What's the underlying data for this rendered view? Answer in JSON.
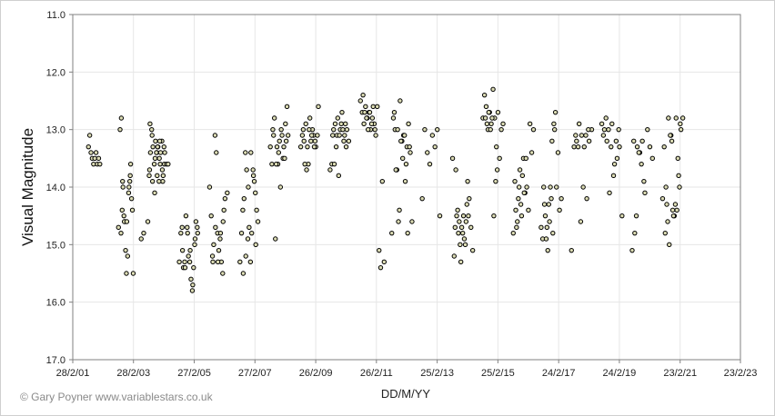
{
  "chart_data": {
    "type": "scatter",
    "title": "",
    "xlabel": "DD/M/YY",
    "ylabel": "Visual Magnitude",
    "y_reversed": true,
    "ylim": [
      11.0,
      17.0
    ],
    "y_ticks": [
      "11.0",
      "12.0",
      "13.0",
      "14.0",
      "15.0",
      "16.0",
      "17.0"
    ],
    "xlim": [
      "2001-02-28",
      "2023-02-23"
    ],
    "x_ticks": [
      "28/2/01",
      "28/2/03",
      "27/2/05",
      "27/2/07",
      "26/2/09",
      "26/2/11",
      "25/2/13",
      "25/2/15",
      "24/2/17",
      "24/2/19",
      "23/2/21",
      "23/2/23"
    ],
    "grid": true,
    "marker_fill": "#dcdcb4",
    "marker_edge": "#000000",
    "x": [
      "2001-09-05",
      "2001-09-20",
      "2001-10-05",
      "2001-10-20",
      "2001-11-05",
      "2001-11-20",
      "2001-12-05",
      "2001-12-20",
      "2002-01-05",
      "2002-01-20",
      "2002-09-01",
      "2002-09-20",
      "2002-10-05",
      "2002-10-20",
      "2002-11-05",
      "2002-11-20",
      "2002-12-05",
      "2002-12-20",
      "2003-01-05",
      "2003-01-15",
      "2003-01-25",
      "2003-02-05",
      "2003-02-15",
      "2003-02-25",
      "2002-10-01",
      "2002-10-15",
      "2002-10-25",
      "2002-11-10",
      "2002-11-25",
      "2002-12-10",
      "2003-01-01",
      "2003-01-20",
      "2003-08-20",
      "2003-09-05",
      "2003-09-20",
      "2003-10-05",
      "2003-10-20",
      "2003-11-05",
      "2003-11-20",
      "2003-12-05",
      "2003-12-20",
      "2004-01-05",
      "2004-01-20",
      "2004-02-05",
      "2004-02-20",
      "2004-03-05",
      "2003-09-15",
      "2003-10-10",
      "2003-11-15",
      "2003-12-10",
      "2004-01-10",
      "2004-02-10",
      "2004-03-01",
      "2003-09-10",
      "2003-10-15",
      "2003-11-10",
      "2003-12-15",
      "2004-01-15",
      "2004-02-15",
      "2004-03-10",
      "2004-04-01",
      "2003-06-01",
      "2003-07-01",
      "2003-12-01",
      "2004-01-01",
      "2004-04-20",
      "2004-09-01",
      "2004-09-20",
      "2004-10-05",
      "2004-10-20",
      "2004-11-05",
      "2004-11-20",
      "2004-12-05",
      "2004-12-20",
      "2005-01-05",
      "2005-01-20",
      "2005-02-05",
      "2005-02-20",
      "2005-03-05",
      "2005-03-20",
      "2005-04-05",
      "2004-10-10",
      "2004-11-10",
      "2004-12-10",
      "2005-01-10",
      "2005-02-10",
      "2005-03-10",
      "2005-04-10",
      "2005-09-01",
      "2005-09-20",
      "2005-10-05",
      "2005-10-20",
      "2005-11-05",
      "2005-11-20",
      "2005-12-05",
      "2005-12-20",
      "2006-01-05",
      "2006-01-20",
      "2006-02-05",
      "2006-02-20",
      "2006-03-05",
      "2006-04-01",
      "2005-10-10",
      "2005-11-10",
      "2005-12-10",
      "2006-01-10",
      "2006-02-10",
      "2006-09-01",
      "2006-09-20",
      "2006-10-05",
      "2006-10-20",
      "2006-11-05",
      "2006-11-20",
      "2006-12-05",
      "2006-12-20",
      "2007-01-05",
      "2007-01-20",
      "2007-02-05",
      "2007-02-20",
      "2007-03-05",
      "2007-03-20",
      "2007-04-05",
      "2006-10-10",
      "2006-11-10",
      "2006-12-10",
      "2007-01-10",
      "2007-02-10",
      "2007-03-10",
      "2007-09-01",
      "2007-10-01",
      "2007-11-01",
      "2007-12-01",
      "2008-01-01",
      "2008-02-01",
      "2008-03-01",
      "2008-04-01",
      "2007-09-20",
      "2007-10-20",
      "2007-11-20",
      "2007-12-20",
      "2008-01-20",
      "2008-02-20",
      "2008-03-20",
      "2007-10-10",
      "2007-11-10",
      "2007-12-10",
      "2008-01-10",
      "2008-02-10",
      "2008-03-10",
      "2008-09-01",
      "2008-10-01",
      "2008-11-01",
      "2008-12-01",
      "2009-01-01",
      "2009-02-01",
      "2009-03-01",
      "2009-04-01",
      "2008-09-20",
      "2008-10-20",
      "2008-11-20",
      "2008-12-20",
      "2009-01-20",
      "2009-02-20",
      "2009-03-20",
      "2008-10-10",
      "2008-11-10",
      "2008-12-10",
      "2009-01-10",
      "2009-02-10",
      "2009-08-20",
      "2009-09-10",
      "2009-10-01",
      "2009-10-20",
      "2009-11-10",
      "2009-12-01",
      "2009-12-20",
      "2010-01-10",
      "2010-02-01",
      "2010-02-20",
      "2010-03-10",
      "2010-04-01",
      "2009-09-20",
      "2009-10-10",
      "2009-11-01",
      "2009-11-20",
      "2009-12-10",
      "2010-01-01",
      "2010-01-20",
      "2010-02-10",
      "2010-03-01",
      "2010-08-20",
      "2010-09-10",
      "2010-10-01",
      "2010-10-20",
      "2010-11-10",
      "2010-12-01",
      "2010-12-20",
      "2011-01-10",
      "2011-02-01",
      "2011-02-20",
      "2011-03-10",
      "2010-09-20",
      "2010-10-10",
      "2010-11-01",
      "2010-11-20",
      "2010-12-10",
      "2011-01-01",
      "2011-01-20",
      "2011-02-10",
      "2011-04-01",
      "2011-04-20",
      "2011-05-10",
      "2011-06-01",
      "2011-09-01",
      "2011-09-20",
      "2011-10-10",
      "2011-11-01",
      "2011-11-20",
      "2011-12-10",
      "2012-01-01",
      "2012-01-20",
      "2012-02-10",
      "2012-03-01",
      "2012-03-20",
      "2012-04-10",
      "2012-05-01",
      "2011-10-01",
      "2011-10-20",
      "2011-11-10",
      "2011-12-01",
      "2011-12-20",
      "2012-01-10",
      "2012-02-01",
      "2012-02-20",
      "2012-03-10",
      "2012-04-01",
      "2012-09-01",
      "2012-10-01",
      "2012-11-01",
      "2012-12-01",
      "2013-01-01",
      "2013-02-01",
      "2013-03-01",
      "2013-04-01",
      "2013-09-01",
      "2013-09-20",
      "2013-10-10",
      "2013-11-01",
      "2013-11-20",
      "2013-12-10",
      "2014-01-01",
      "2014-01-20",
      "2014-02-10",
      "2014-03-01",
      "2014-03-20",
      "2014-04-10",
      "2014-05-01",
      "2013-10-01",
      "2013-10-20",
      "2013-11-10",
      "2013-12-01",
      "2013-12-20",
      "2014-01-10",
      "2014-02-01",
      "2014-02-20",
      "2014-03-10",
      "2014-09-01",
      "2014-09-20",
      "2014-10-10",
      "2014-11-01",
      "2014-11-20",
      "2014-12-10",
      "2015-01-01",
      "2015-01-20",
      "2015-02-10",
      "2015-03-01",
      "2015-03-20",
      "2015-04-10",
      "2015-05-01",
      "2014-10-01",
      "2014-10-20",
      "2014-11-10",
      "2014-12-01",
      "2014-12-20",
      "2015-01-10",
      "2015-02-01",
      "2015-02-20",
      "2015-09-01",
      "2015-09-20",
      "2015-10-10",
      "2015-11-01",
      "2015-11-20",
      "2015-12-10",
      "2016-01-01",
      "2016-01-20",
      "2016-02-10",
      "2016-03-01",
      "2016-03-20",
      "2016-04-10",
      "2016-05-01",
      "2015-10-01",
      "2015-10-20",
      "2015-11-10",
      "2015-12-01",
      "2015-12-20",
      "2016-01-10",
      "2016-02-01",
      "2016-08-01",
      "2016-08-20",
      "2016-09-10",
      "2016-10-01",
      "2016-10-20",
      "2016-11-10",
      "2016-12-01",
      "2016-12-20",
      "2017-01-10",
      "2017-02-01",
      "2017-02-20",
      "2017-03-10",
      "2017-04-01",
      "2016-09-01",
      "2016-09-20",
      "2016-10-10",
      "2016-11-01",
      "2016-11-20",
      "2016-12-10",
      "2017-01-01",
      "2017-01-20",
      "2017-08-01",
      "2017-09-01",
      "2017-10-01",
      "2017-11-01",
      "2017-12-01",
      "2018-01-01",
      "2018-02-01",
      "2018-03-01",
      "2018-04-01",
      "2017-09-20",
      "2017-10-20",
      "2017-11-20",
      "2017-12-20",
      "2018-01-20",
      "2018-02-20",
      "2018-08-01",
      "2018-09-01",
      "2018-10-01",
      "2018-11-01",
      "2018-12-01",
      "2019-01-01",
      "2019-02-01",
      "2019-03-01",
      "2019-04-01",
      "2018-08-20",
      "2018-09-20",
      "2018-10-20",
      "2018-11-20",
      "2018-12-20",
      "2019-01-20",
      "2019-02-20",
      "2019-08-01",
      "2019-09-01",
      "2019-10-01",
      "2019-11-01",
      "2019-12-01",
      "2020-01-01",
      "2020-02-01",
      "2020-03-01",
      "2020-04-01",
      "2019-08-20",
      "2019-09-20",
      "2019-10-20",
      "2019-11-20",
      "2019-12-20",
      "2020-08-01",
      "2020-08-20",
      "2020-09-10",
      "2020-10-01",
      "2020-10-20",
      "2020-11-10",
      "2020-12-01",
      "2020-12-20",
      "2021-01-10",
      "2021-02-01",
      "2021-02-20",
      "2021-03-10",
      "2021-04-01",
      "2020-09-01",
      "2020-09-20",
      "2020-10-10",
      "2020-11-01",
      "2020-11-20",
      "2020-12-10",
      "2021-01-01",
      "2021-01-20",
      "2021-02-10",
      "2021-03-01"
    ],
    "y": [
      13.3,
      13.1,
      13.4,
      13.5,
      13.6,
      13.5,
      13.4,
      13.6,
      13.5,
      13.6,
      14.7,
      13.0,
      12.8,
      13.9,
      14.5,
      14.6,
      15.5,
      15.2,
      14.0,
      13.9,
      13.6,
      14.2,
      14.4,
      15.5,
      14.8,
      14.4,
      14.0,
      14.6,
      15.1,
      14.6,
      14.1,
      13.8,
      14.6,
      13.8,
      13.4,
      13.0,
      13.3,
      13.6,
      13.2,
      13.4,
      13.3,
      13.5,
      13.4,
      13.2,
      13.8,
      13.6,
      12.9,
      13.1,
      13.5,
      13.8,
      13.2,
      13.7,
      13.3,
      13.7,
      13.9,
      14.1,
      13.3,
      13.6,
      13.9,
      13.4,
      13.6,
      14.9,
      14.8,
      13.4,
      13.9,
      13.6,
      15.3,
      14.8,
      14.7,
      15.4,
      15.3,
      14.5,
      14.7,
      15.2,
      15.3,
      15.6,
      15.8,
      15.4,
      15.0,
      14.6,
      14.7,
      15.1,
      15.4,
      14.8,
      15.1,
      15.7,
      14.9,
      14.8,
      14.0,
      14.5,
      15.2,
      15.0,
      13.1,
      13.4,
      14.8,
      15.1,
      14.9,
      15.3,
      15.5,
      14.4,
      14.2,
      14.1,
      15.3,
      14.7,
      15.3,
      14.8,
      14.6,
      15.3,
      14.8,
      14.4,
      14.2,
      13.4,
      13.7,
      14.9,
      14.7,
      15.3,
      14.8,
      13.7,
      13.9,
      14.1,
      14.4,
      14.6,
      15.5,
      15.2,
      14.0,
      13.4,
      13.8,
      15.0,
      13.3,
      13.0,
      14.9,
      13.6,
      14.0,
      13.5,
      12.9,
      13.1,
      13.6,
      12.8,
      13.3,
      13.2,
      13.1,
      13.5,
      12.6,
      13.1,
      13.6,
      13.4,
      13.0,
      13.3,
      13.2,
      13.3,
      13.0,
      12.9,
      13.6,
      13.2,
      13.1,
      13.3,
      12.6,
      13.1,
      13.6,
      13.3,
      12.8,
      13.0,
      13.2,
      13.1,
      13.2,
      13.7,
      13.0,
      13.1,
      13.3,
      13.7,
      13.6,
      13.0,
      12.9,
      13.1,
      13.8,
      13.0,
      12.7,
      13.2,
      12.9,
      13.0,
      13.2,
      13.1,
      13.6,
      13.3,
      12.8,
      13.1,
      12.9,
      13.0,
      13.1,
      13.3,
      12.5,
      12.7,
      12.9,
      12.6,
      12.8,
      12.7,
      13.0,
      12.8,
      12.9,
      13.1,
      12.6,
      12.4,
      12.7,
      12.8,
      13.0,
      12.7,
      12.9,
      12.6,
      13.0,
      15.1,
      15.4,
      13.9,
      15.3,
      14.8,
      12.8,
      13.0,
      13.7,
      14.6,
      12.5,
      13.2,
      13.1,
      13.9,
      13.3,
      12.9,
      13.4,
      14.6,
      12.7,
      13.7,
      13.0,
      14.4,
      13.2,
      13.5,
      13.1,
      13.6,
      14.8,
      13.3,
      14.2,
      13.0,
      13.4,
      13.6,
      13.1,
      13.3,
      13.0,
      14.5,
      13.5,
      15.2,
      13.7,
      14.4,
      14.6,
      15.3,
      14.8,
      14.9,
      14.6,
      13.9,
      14.2,
      14.7,
      15.1,
      14.7,
      14.5,
      14.8,
      15.0,
      14.7,
      14.5,
      15.0,
      14.3,
      14.5,
      12.8,
      12.4,
      12.6,
      13.0,
      12.7,
      12.9,
      12.3,
      12.8,
      13.3,
      12.7,
      13.5,
      13.0,
      12.9,
      12.8,
      12.9,
      12.7,
      13.0,
      12.8,
      14.5,
      13.9,
      13.7,
      14.8,
      13.9,
      14.7,
      14.2,
      13.7,
      14.5,
      13.5,
      14.1,
      14.0,
      14.4,
      12.9,
      13.4,
      13.0,
      14.4,
      14.6,
      14.0,
      14.3,
      13.8,
      14.1,
      13.5,
      14.7,
      14.9,
      14.3,
      14.9,
      15.1,
      14.6,
      14.2,
      14.8,
      13.0,
      14.0,
      13.4,
      14.4,
      14.2,
      14.0,
      14.5,
      14.7,
      14.3,
      14.0,
      13.2,
      12.9,
      12.7,
      15.1,
      13.3,
      13.2,
      12.9,
      13.1,
      13.3,
      14.2,
      13.2,
      13.0,
      13.1,
      13.3,
      14.6,
      14.0,
      13.1,
      13.0,
      12.9,
      13.0,
      13.2,
      14.1,
      12.9,
      13.6,
      13.5,
      13.3,
      14.5,
      13.1,
      12.8,
      13.0,
      13.3,
      13.8,
      13.2,
      13.0,
      15.1,
      14.8,
      13.3,
      13.4,
      13.2,
      14.1,
      13.0,
      13.3,
      13.5,
      13.2,
      14.5,
      13.4,
      13.6,
      13.9,
      14.2,
      13.3,
      14.0,
      14.6,
      15.0,
      13.1,
      14.4,
      14.5,
      12.8,
      13.5,
      14.0,
      13.0,
      12.8,
      14.8,
      14.3,
      12.8,
      13.1,
      13.2,
      14.5,
      14.3,
      14.4,
      13.8,
      12.9
    ]
  },
  "plot_area": {
    "background": "#ffffff",
    "grid_color": "#e6e6e6",
    "border_color": "#808080"
  },
  "credit": "© Gary Poyner  www.variablestars.co.uk"
}
